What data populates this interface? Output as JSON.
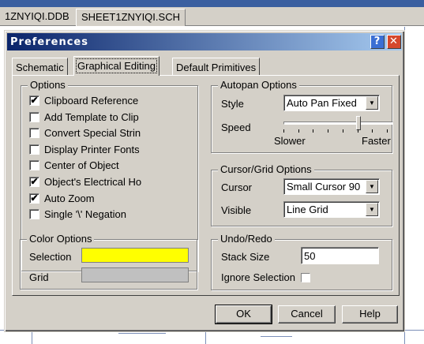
{
  "app": {
    "doc_tabs": [
      "1ZNYIQI.DDB",
      "SHEET1ZNYIQI.SCH"
    ]
  },
  "dialog": {
    "title": "Preferences",
    "help_glyph": "?",
    "close_glyph": "✕",
    "tabs": [
      {
        "label": "Schematic",
        "active": false
      },
      {
        "label": "Graphical Editing",
        "active": true
      },
      {
        "label": "Default Primitives",
        "active": false
      }
    ],
    "options": {
      "title": "Options",
      "items": [
        {
          "label": "Clipboard Reference",
          "checked": true
        },
        {
          "label": "Add Template to Clip",
          "checked": false
        },
        {
          "label": "Convert Special Strin",
          "checked": false
        },
        {
          "label": "Display Printer Fonts",
          "checked": false
        },
        {
          "label": "Center of Object",
          "checked": false
        },
        {
          "label": "Object's Electrical Ho",
          "checked": true
        },
        {
          "label": "Auto Zoom",
          "checked": true
        },
        {
          "label": "Single '\\' Negation",
          "checked": false
        }
      ],
      "check_glyph": "✔"
    },
    "autopan": {
      "title": "Autopan Options",
      "style_label": "Style",
      "style_value": "Auto Pan Fixed",
      "speed_label": "Speed",
      "slower_label": "Slower",
      "faster_label": "Faster",
      "speed_level": 0.7
    },
    "cursor_grid": {
      "title": "Cursor/Grid Options",
      "cursor_label": "Cursor",
      "cursor_value": "Small Cursor 90",
      "visible_label": "Visible",
      "visible_value": "Line Grid"
    },
    "color_options": {
      "title": "Color Options",
      "selection_label": "Selection",
      "selection_color": "#ffff00",
      "grid_label": "Grid",
      "grid_color": "#c0c0c0"
    },
    "undo_redo": {
      "title": "Undo/Redo",
      "stack_size_label": "Stack Size",
      "stack_size_value": "50",
      "ignore_selection_label": "Ignore Selection",
      "ignore_selection_checked": false
    },
    "buttons": {
      "ok": "OK",
      "cancel": "Cancel",
      "help": "Help"
    },
    "combo_arrow": "▼"
  },
  "colors": {
    "face": "#d4d0c8",
    "title_start": "#0a246a",
    "title_end": "#a6caf0"
  }
}
